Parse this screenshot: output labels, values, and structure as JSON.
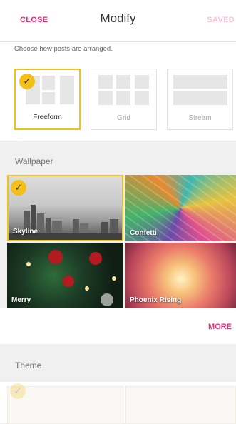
{
  "header": {
    "close_label": "CLOSE",
    "title": "Modify",
    "saved_label": "SAVED"
  },
  "layout": {
    "hint": "Choose how posts are arranged.",
    "options": [
      {
        "label": "Freeform",
        "selected": true
      },
      {
        "label": "Grid",
        "selected": false
      },
      {
        "label": "Stream",
        "selected": false
      }
    ]
  },
  "wallpaper": {
    "section_label": "Wallpaper",
    "tiles": [
      {
        "label": "Skyline",
        "selected": true
      },
      {
        "label": "Confetti",
        "selected": false
      },
      {
        "label": "Merry",
        "selected": false
      },
      {
        "label": "Phoenix Rising",
        "selected": false
      }
    ],
    "more_label": "MORE"
  },
  "theme": {
    "section_label": "Theme"
  },
  "icons": {
    "check": "check-icon"
  },
  "colors": {
    "accent": "#e8297a",
    "selected": "#f3bf1a"
  }
}
